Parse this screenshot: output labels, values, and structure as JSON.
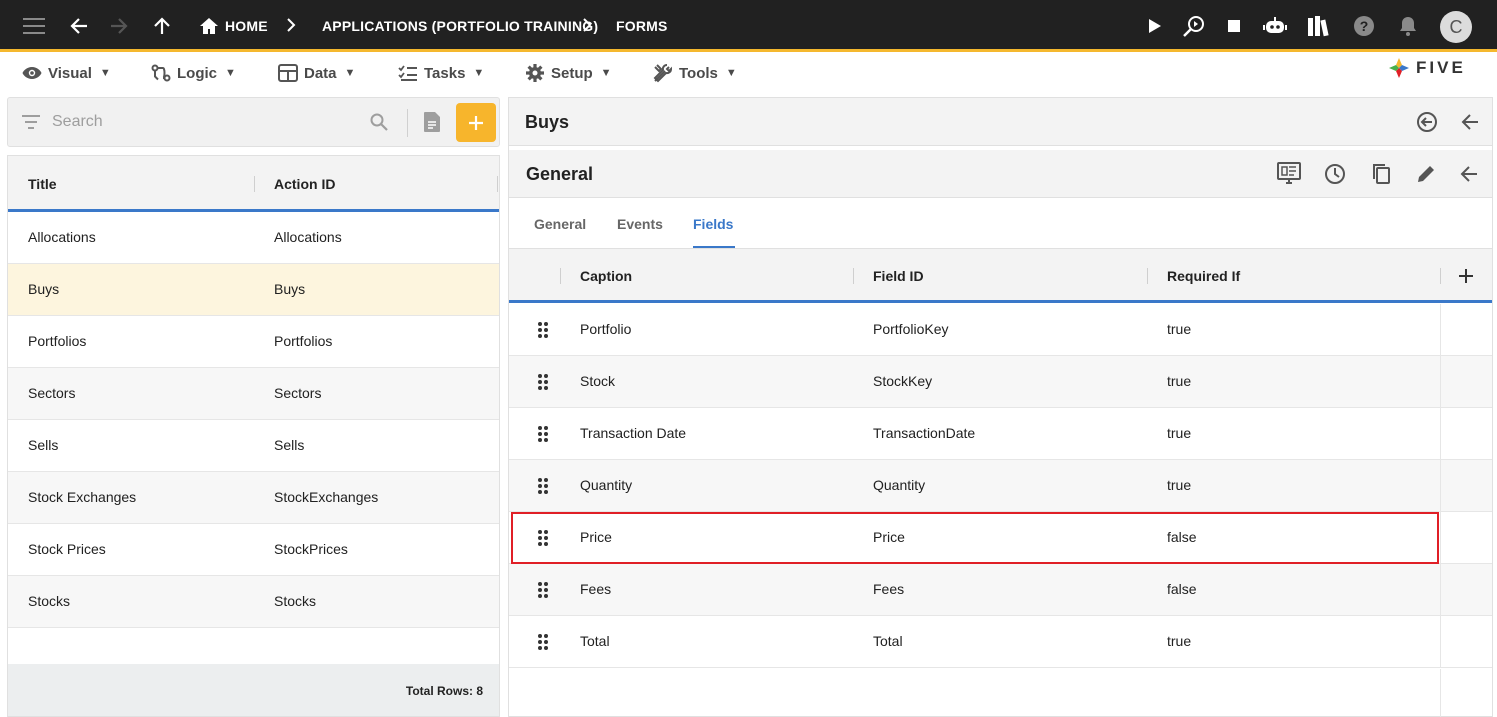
{
  "topbar": {
    "breadcrumbs": [
      "HOME",
      "APPLICATIONS (PORTFOLIO TRAINING)",
      "FORMS"
    ],
    "avatar_initial": "C",
    "icons": [
      "menu-icon",
      "back-arrow-icon",
      "forward-arrow-icon",
      "up-arrow-icon",
      "home-icon",
      "play-icon",
      "debug-search-icon",
      "stop-icon",
      "chatbot-icon",
      "library-icon",
      "help-icon",
      "bell-icon"
    ]
  },
  "menu": {
    "items": [
      {
        "label": "Visual",
        "icon": "eye-icon"
      },
      {
        "label": "Logic",
        "icon": "logic-icon"
      },
      {
        "label": "Data",
        "icon": "table-icon"
      },
      {
        "label": "Tasks",
        "icon": "tasks-icon"
      },
      {
        "label": "Setup",
        "icon": "gear-icon"
      },
      {
        "label": "Tools",
        "icon": "tools-icon"
      }
    ],
    "caret": "▼",
    "logo_text": "FIVE"
  },
  "left": {
    "search_placeholder": "Search",
    "columns": [
      "Title",
      "Action ID"
    ],
    "rows": [
      {
        "title": "Allocations",
        "action_id": "Allocations"
      },
      {
        "title": "Buys",
        "action_id": "Buys"
      },
      {
        "title": "Portfolios",
        "action_id": "Portfolios"
      },
      {
        "title": "Sectors",
        "action_id": "Sectors"
      },
      {
        "title": "Sells",
        "action_id": "Sells"
      },
      {
        "title": "Stock Exchanges",
        "action_id": "StockExchanges"
      },
      {
        "title": "Stock Prices",
        "action_id": "StockPrices"
      },
      {
        "title": "Stocks",
        "action_id": "Stocks"
      }
    ],
    "selected_index": 1,
    "footer": "Total Rows: 8"
  },
  "right": {
    "title": "Buys",
    "section_title": "General",
    "tabs": [
      "General",
      "Events",
      "Fields"
    ],
    "active_tab": "Fields",
    "columns": [
      "Caption",
      "Field ID",
      "Required If"
    ],
    "rows": [
      {
        "caption": "Portfolio",
        "field_id": "PortfolioKey",
        "required_if": "true"
      },
      {
        "caption": "Stock",
        "field_id": "StockKey",
        "required_if": "true"
      },
      {
        "caption": "Transaction Date",
        "field_id": "TransactionDate",
        "required_if": "true"
      },
      {
        "caption": "Quantity",
        "field_id": "Quantity",
        "required_if": "true"
      },
      {
        "caption": "Price",
        "field_id": "Price",
        "required_if": "false"
      },
      {
        "caption": "Fees",
        "field_id": "Fees",
        "required_if": "false"
      },
      {
        "caption": "Total",
        "field_id": "Total",
        "required_if": "true"
      }
    ],
    "highlighted_index": 4
  },
  "colors": {
    "accent": "#f7b52c",
    "primary_blue": "#3a78c9",
    "highlight_red": "#e01f26",
    "topbar_bg": "#212121"
  }
}
